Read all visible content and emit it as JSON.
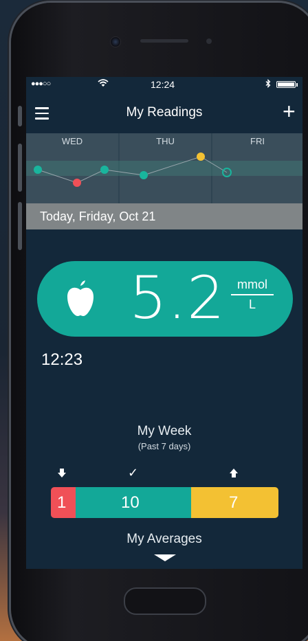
{
  "status_bar": {
    "signal": "●●●○○",
    "time": "12:24"
  },
  "nav": {
    "title": "My Readings"
  },
  "trend": {
    "days": [
      "WED",
      "THU",
      "FRI"
    ],
    "point_colors": {
      "in_range": "#19b59d",
      "low": "#f05057",
      "high": "#f3c133"
    }
  },
  "date_bar": {
    "label": "Today, Friday, Oct 21"
  },
  "reading": {
    "value": "5.2",
    "unit_top": "mmol",
    "unit_bottom": "L",
    "time": "12:23",
    "icon": "apple-icon"
  },
  "week": {
    "title": "My Week",
    "subtitle": "(Past 7 days)",
    "low_count": "1",
    "in_range_count": "10",
    "high_count": "7"
  },
  "averages": {
    "label": "My Averages"
  },
  "colors": {
    "screen_bg": "#13283a",
    "teal": "#13a898",
    "red": "#f05057",
    "yellow": "#f3c133"
  }
}
